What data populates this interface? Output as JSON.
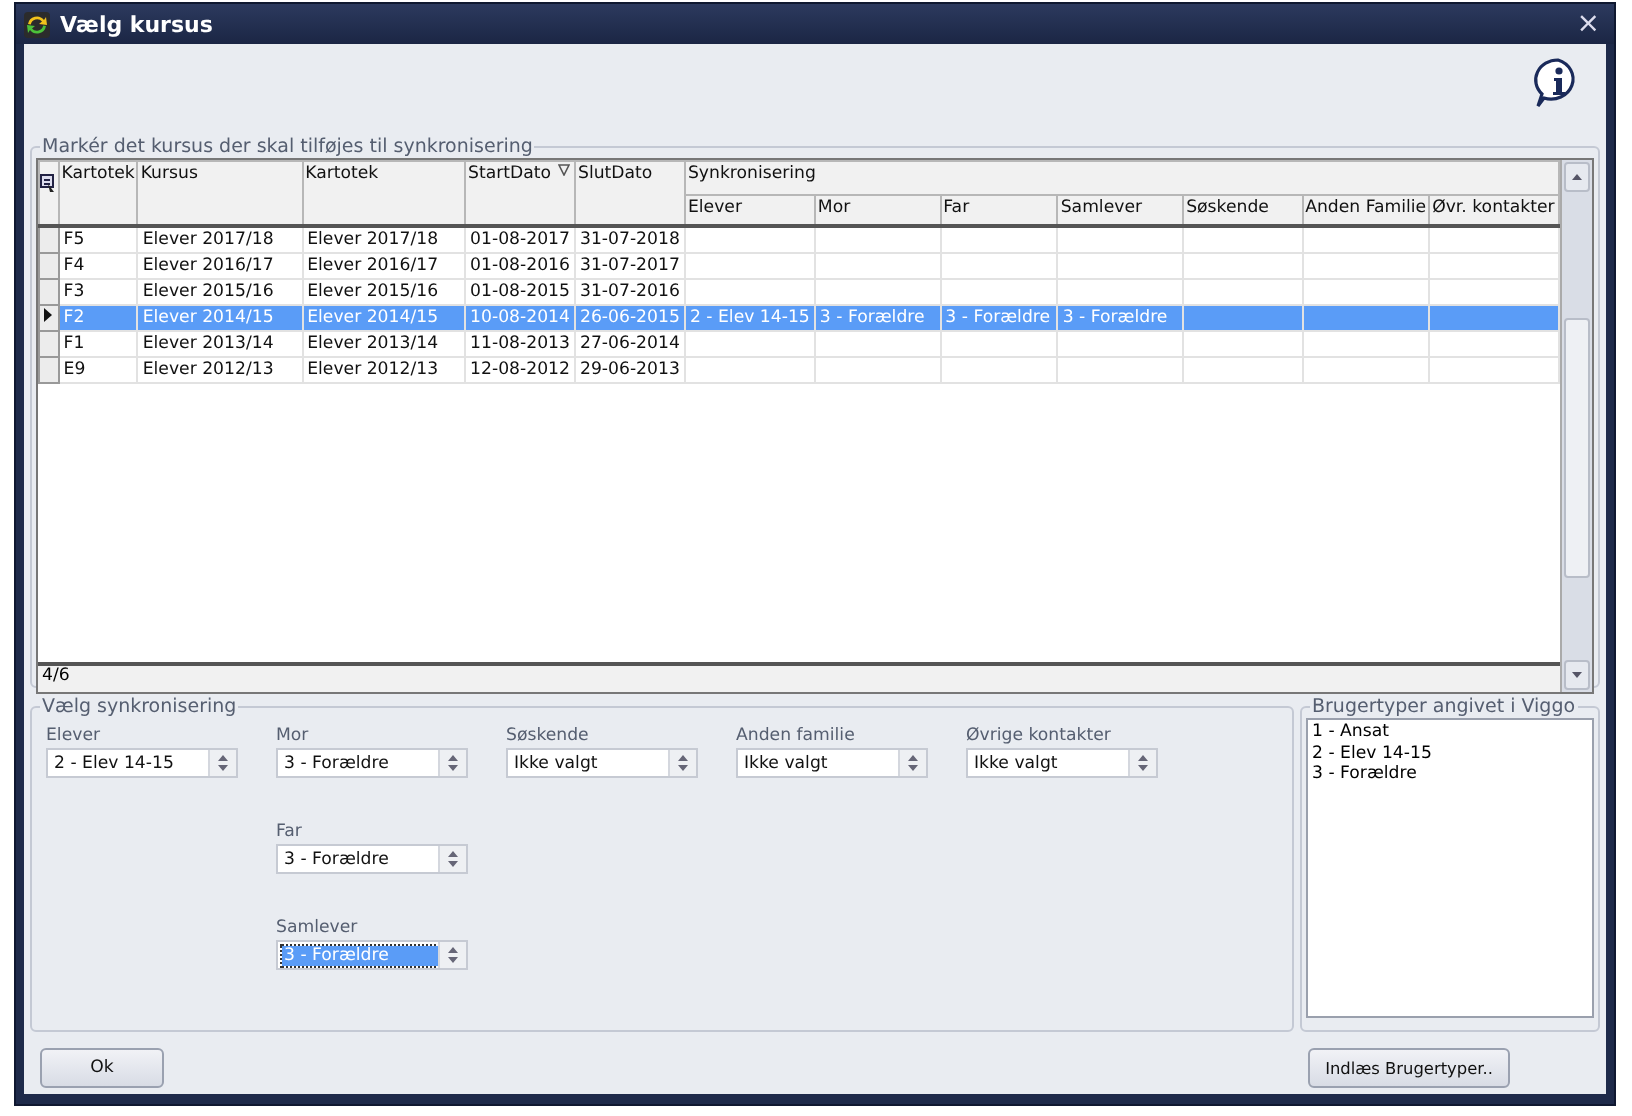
{
  "window": {
    "title": "Vælg kursus",
    "close": "×"
  },
  "grid": {
    "title": "Markér det kursus der skal tilføjes til synkronisering",
    "columns": [
      {
        "label": "Kartotek",
        "sorted": false
      },
      {
        "label": "Kursus",
        "sorted": false
      },
      {
        "label": "Kartotek",
        "sorted": false
      },
      {
        "label": "StartDato",
        "sorted": true
      },
      {
        "label": "SlutDato",
        "sorted": false
      }
    ],
    "sync_group": "Synkronisering",
    "sync_columns": [
      "Elever",
      "Mor",
      "Far",
      "Samlever",
      "Søskende",
      "Anden Familie",
      "Øvr. kontakter"
    ],
    "rows": [
      {
        "selected": false,
        "cells": [
          "F5",
          "Elever 2017/18",
          "Elever 2017/18",
          "01-08-2017",
          "31-07-2018",
          null,
          null,
          null,
          null,
          null,
          null,
          null
        ]
      },
      {
        "selected": false,
        "cells": [
          "F4",
          "Elever 2016/17",
          "Elever 2016/17",
          "01-08-2016",
          "31-07-2017",
          null,
          null,
          null,
          null,
          null,
          null,
          null
        ]
      },
      {
        "selected": false,
        "cells": [
          "F3",
          "Elever 2015/16",
          "Elever 2015/16",
          "01-08-2015",
          "31-07-2016",
          null,
          null,
          null,
          null,
          null,
          null,
          null
        ]
      },
      {
        "selected": true,
        "cells": [
          "F2",
          "Elever 2014/15",
          "Elever 2014/15",
          "10-08-2014",
          "26-06-2015",
          "2 - Elev 14-15",
          "3 - Forældre",
          "3 - Forældre",
          "3 - Forældre",
          null,
          null,
          null
        ]
      },
      {
        "selected": false,
        "cells": [
          "F1",
          "Elever 2013/14",
          "Elever 2013/14",
          "11-08-2013",
          "27-06-2014",
          null,
          null,
          null,
          null,
          null,
          null,
          null
        ]
      },
      {
        "selected": false,
        "cells": [
          "E9",
          "Elever 2012/13",
          "Elever 2012/13",
          "12-08-2012",
          "29-06-2013",
          null,
          null,
          null,
          null,
          null,
          null,
          null
        ]
      }
    ],
    "record_counter": "4/6"
  },
  "sync": {
    "title": "Vælg synkronisering",
    "columns": [
      [
        {
          "label": "Elever",
          "value": "2 - Elev 14-15",
          "focused": false
        }
      ],
      [
        {
          "label": "Mor",
          "value": "3 - Forældre",
          "focused": false
        },
        {
          "label": "Far",
          "value": "3 - Forældre",
          "focused": false
        },
        {
          "label": "Samlever",
          "value": "3 - Forældre",
          "focused": true
        }
      ],
      [
        {
          "label": "Søskende",
          "value": "Ikke valgt",
          "focused": false
        }
      ],
      [
        {
          "label": "Anden familie",
          "value": "Ikke valgt",
          "focused": false
        }
      ],
      [
        {
          "label": "Øvrige kontakter",
          "value": "Ikke valgt",
          "focused": false
        }
      ]
    ]
  },
  "user_types": {
    "title": "Brugertyper angivet i Viggo",
    "items": [
      "1 - Ansat",
      "2 - Elev 14-15",
      "3 - Forældre"
    ]
  },
  "buttons": {
    "ok": "Ok",
    "load": "Indlæs Brugertyper.."
  }
}
